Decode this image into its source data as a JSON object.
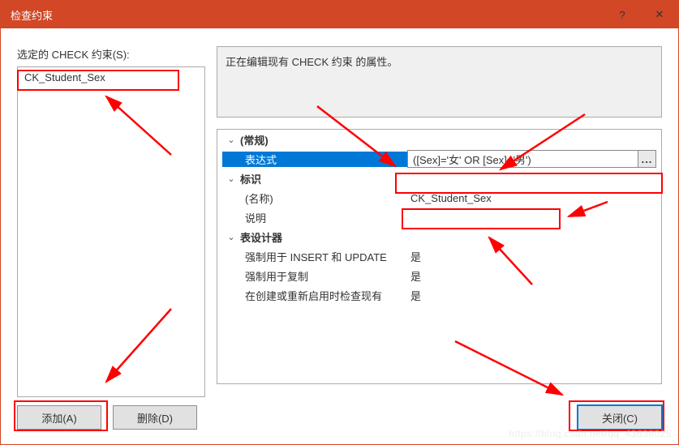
{
  "window": {
    "title": "检查约束",
    "help_glyph": "?",
    "close_glyph": "✕"
  },
  "left": {
    "label": "选定的 CHECK 约束(S):",
    "items": [
      "CK_Student_Sex"
    ],
    "add_label": "添加(A)",
    "delete_label": "删除(D)"
  },
  "right": {
    "description": "正在编辑现有 CHECK 约束 的属性。",
    "categories": {
      "general": {
        "label": "(常规)",
        "expression_label": "表达式",
        "expression_value": "([Sex]='女' OR [Sex]='男')"
      },
      "identity": {
        "label": "标识",
        "name_label": "(名称)",
        "name_value": "CK_Student_Sex",
        "desc_label": "说明",
        "desc_value": ""
      },
      "designer": {
        "label": "表设计器",
        "r1_label": "强制用于 INSERT 和 UPDATE",
        "r1_value": "是",
        "r2_label": "强制用于复制",
        "r2_value": "是",
        "r3_label": "在创建或重新启用时检查现有",
        "r3_value": "是"
      }
    },
    "ellipsis": "...",
    "close_label": "关闭(C)"
  },
  "glyphs": {
    "expander": "⌄"
  },
  "watermark": "https://blog.csdn.net/qq_43638025"
}
